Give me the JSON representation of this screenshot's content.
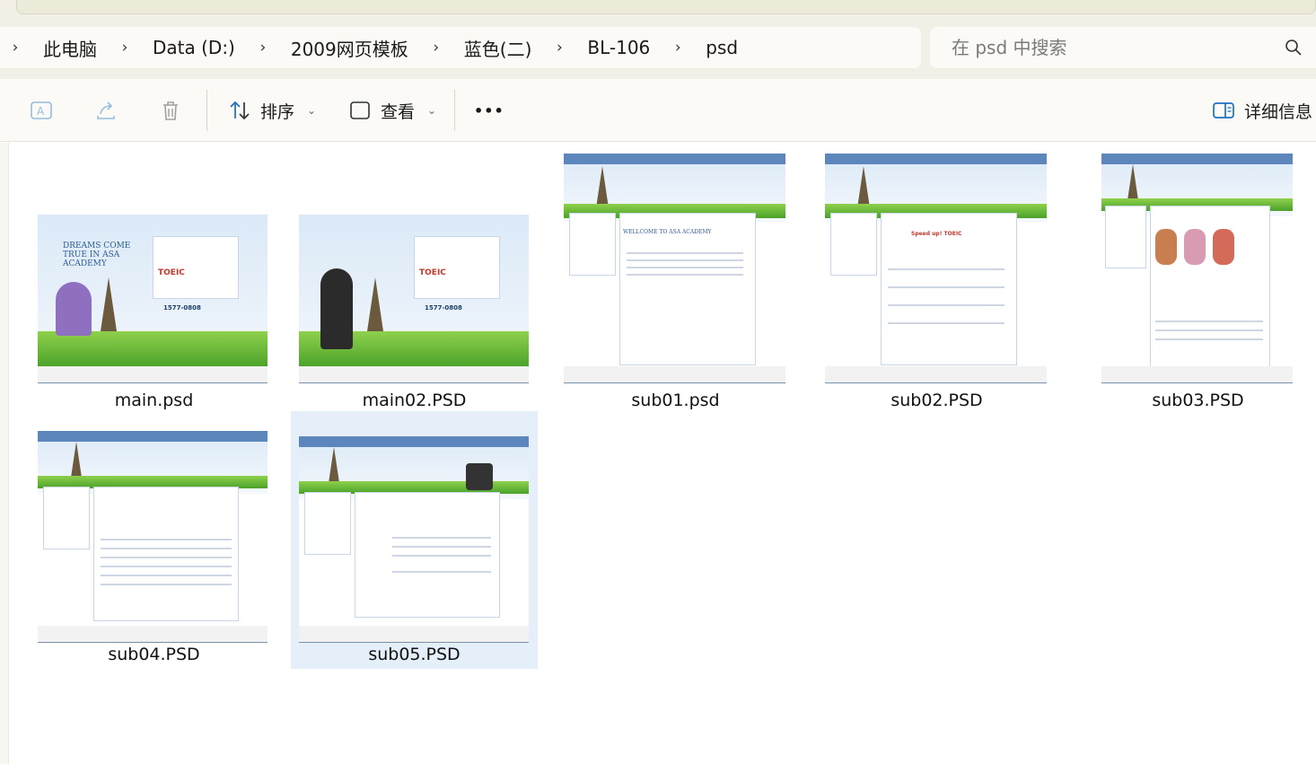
{
  "breadcrumb": {
    "items": [
      "此电脑",
      "Data (D:)",
      "2009网页模板",
      "蓝色(二)",
      "BL-106",
      "psd"
    ]
  },
  "search": {
    "placeholder": "在 psd 中搜索"
  },
  "toolbar": {
    "sort_label": "排序",
    "view_label": "查看",
    "more_label": "•••",
    "details_label": "详细信息"
  },
  "files": [
    {
      "name": "main.psd"
    },
    {
      "name": "main02.PSD"
    },
    {
      "name": "sub01.psd"
    },
    {
      "name": "sub02.PSD"
    },
    {
      "name": "sub03.PSD"
    },
    {
      "name": "sub04.PSD"
    },
    {
      "name": "sub05.PSD"
    }
  ],
  "thumb_text": {
    "main": "DREAMS COME TRUE IN ASA ACADEMY",
    "sub01": "WELLCOME TO ASA ACADEMY",
    "sub02": "Speed up! TOEIC",
    "toeic": "TOEIC",
    "phone": "1577-0808"
  },
  "selected_file": "sub05.PSD",
  "colors": {
    "selection": "#e5effa",
    "accent": "#5d86bd"
  }
}
